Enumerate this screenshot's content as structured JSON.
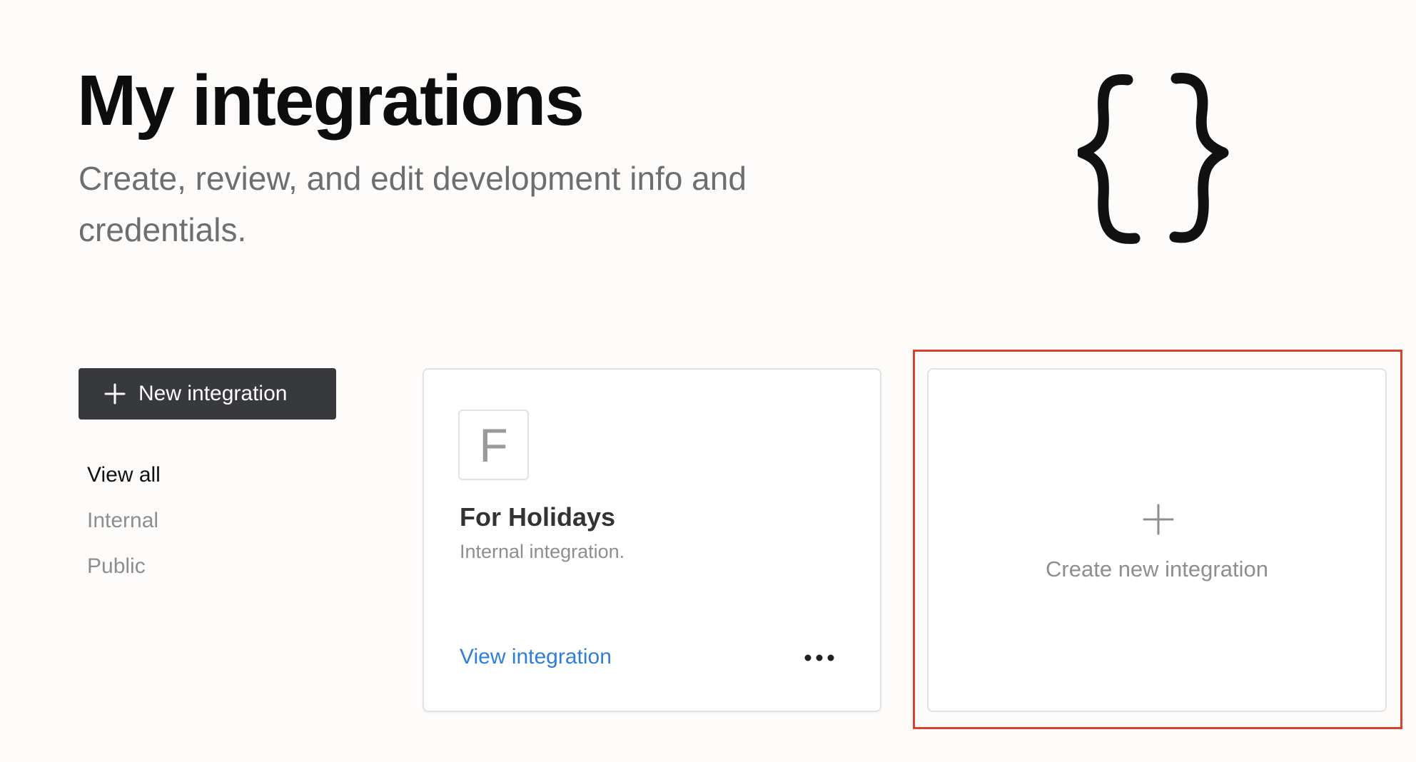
{
  "header": {
    "title": "My integrations",
    "subtitle": "Create, review, and edit development info and credentials."
  },
  "toolbar": {
    "new_integration_label": "New integration"
  },
  "filters": [
    {
      "label": "View all",
      "active": true
    },
    {
      "label": "Internal",
      "active": false
    },
    {
      "label": "Public",
      "active": false
    }
  ],
  "integrations": [
    {
      "initial": "F",
      "name": "For Holidays",
      "type": "Internal integration.",
      "link_label": "View integration"
    }
  ],
  "create_card": {
    "label": "Create new integration"
  },
  "colors": {
    "background": "#fdfcfb",
    "primary_button": "#37393c",
    "link": "#2f7fd6",
    "highlight": "#d9402e",
    "muted_text": "#8e8e8e"
  },
  "icons": {
    "illustration": "curly-braces-icon",
    "add": "plus-icon",
    "more": "more-horizontal-icon"
  }
}
